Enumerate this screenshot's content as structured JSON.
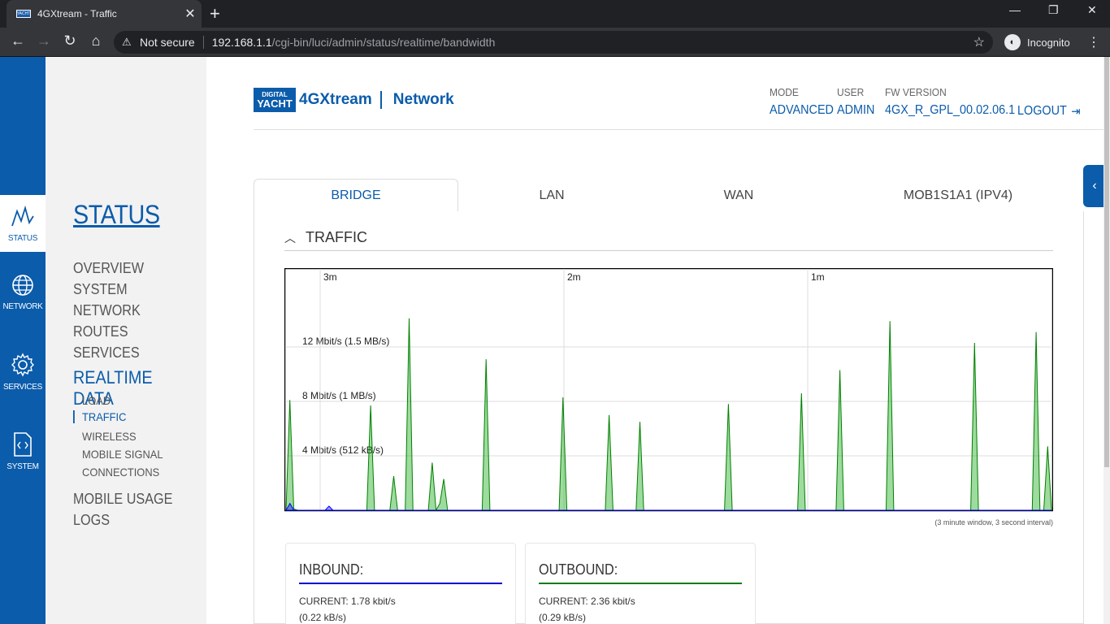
{
  "browser": {
    "tab_title": "4GXtream - Traffic",
    "tab_favicon_text": "YACHT",
    "url_security": "Not secure",
    "url_host": "192.168.1.1",
    "url_path": "/cgi-bin/luci/admin/status/realtime/bandwidth",
    "profile": "Incognito"
  },
  "iconbar": {
    "items": [
      {
        "label": "STATUS",
        "icon": "status-icon",
        "active": true
      },
      {
        "label": "NETWORK",
        "icon": "globe-icon",
        "active": false
      },
      {
        "label": "SERVICES",
        "icon": "gear-icon",
        "active": false
      },
      {
        "label": "SYSTEM",
        "icon": "system-icon",
        "active": false
      }
    ]
  },
  "sidebar": {
    "title": "STATUS",
    "items": [
      "OVERVIEW",
      "SYSTEM",
      "NETWORK",
      "ROUTES",
      "SERVICES"
    ],
    "active_item": "REALTIME DATA",
    "sub_items": [
      "LOAD",
      "TRAFFIC",
      "WIRELESS",
      "MOBILE SIGNAL",
      "CONNECTIONS"
    ],
    "active_sub": "TRAFFIC",
    "after_items": [
      "MOBILE USAGE",
      "LOGS"
    ]
  },
  "header": {
    "logo_top": "DIGITAL",
    "logo_bottom": "YACHT",
    "product": "4GXtream",
    "section": "Network",
    "mode_label": "MODE",
    "mode_value": "ADVANCED",
    "user_label": "USER",
    "user_value": "ADMIN",
    "fw_label": "FW VERSION",
    "fw_value": "4GX_R_GPL_00.02.06.1",
    "logout": "LOGOUT"
  },
  "tabs": [
    {
      "label": "BRIDGE",
      "active": true
    },
    {
      "label": "LAN",
      "active": false
    },
    {
      "label": "WAN",
      "active": false
    },
    {
      "label": "MOB1S1A1 (IPV4)",
      "active": false
    }
  ],
  "section": {
    "title": "TRAFFIC"
  },
  "chart_data": {
    "type": "area",
    "x_markers": [
      "3m",
      "2m",
      "1m"
    ],
    "y_ticks": [
      "12 Mbit/s (1.5 MB/s)",
      "8 Mbit/s (1 MB/s)",
      "4 Mbit/s (512 kB/s)"
    ],
    "y_tick_values_mbit": [
      12,
      8,
      4
    ],
    "ylim_mbit": [
      0,
      16
    ],
    "note": "(3 minute window, 3 second interval)",
    "series": [
      {
        "name": "OUTBOUND",
        "color": "#008000",
        "values": [
          0,
          8.1,
          0.1,
          0,
          0,
          0,
          0,
          0,
          0,
          0,
          0,
          0,
          0,
          0,
          0,
          0,
          0,
          0,
          0,
          0,
          0,
          0,
          7.7,
          0,
          0,
          0,
          0,
          0,
          2.5,
          0,
          0,
          0,
          14.1,
          0,
          0,
          0,
          0,
          0,
          3.5,
          0,
          0.5,
          2.3,
          0,
          0,
          0,
          0,
          0,
          0,
          0,
          0,
          0,
          0,
          11.1,
          0,
          0,
          0,
          0,
          0,
          0,
          0,
          0,
          0,
          0,
          0,
          0,
          0,
          0,
          0,
          0,
          0,
          0,
          0,
          8.3,
          0,
          0,
          0,
          0,
          0,
          0,
          0,
          0,
          0,
          0,
          0,
          7.0,
          0,
          0,
          0,
          0,
          0,
          0,
          0,
          6.5,
          0,
          0,
          0,
          0,
          0,
          0,
          0,
          0,
          0,
          0,
          0,
          0,
          0,
          0,
          0,
          0,
          0,
          0,
          0,
          0,
          0,
          0,
          7.8,
          0,
          0,
          0,
          0,
          0,
          0,
          0,
          0,
          0,
          0,
          0,
          0,
          0,
          0,
          0,
          0,
          0,
          0,
          8.6,
          0,
          0,
          0,
          0,
          0,
          0,
          0,
          0,
          0,
          10.3,
          0,
          0,
          0,
          0,
          0,
          0,
          0,
          0,
          0,
          0,
          0,
          0,
          13.9,
          0,
          0,
          0,
          0,
          0,
          0,
          0,
          0,
          0,
          0,
          0,
          0,
          0,
          0,
          0,
          0,
          0,
          0,
          0,
          0,
          0,
          12.3,
          0,
          0,
          0,
          0,
          0,
          0,
          0,
          0,
          0,
          0,
          0,
          0,
          0,
          0,
          0,
          13.1,
          0,
          0,
          4.7,
          0
        ]
      },
      {
        "name": "INBOUND",
        "color": "#0000ff",
        "values": [
          0,
          0.5,
          0,
          0,
          0,
          0,
          0,
          0,
          0,
          0,
          0,
          0.3,
          0,
          0,
          0,
          0,
          0,
          0,
          0,
          0,
          0,
          0,
          0,
          0,
          0,
          0,
          0,
          0,
          0,
          0,
          0,
          0,
          0,
          0,
          0,
          0,
          0,
          0,
          0,
          0,
          0,
          0,
          0,
          0,
          0,
          0,
          0,
          0,
          0,
          0,
          0,
          0,
          0,
          0,
          0,
          0,
          0,
          0,
          0,
          0,
          0,
          0,
          0,
          0,
          0,
          0,
          0,
          0,
          0,
          0,
          0,
          0,
          0,
          0,
          0,
          0,
          0,
          0,
          0,
          0,
          0,
          0,
          0,
          0,
          0,
          0,
          0,
          0,
          0,
          0,
          0,
          0,
          0,
          0,
          0,
          0,
          0,
          0,
          0,
          0,
          0,
          0,
          0,
          0,
          0,
          0,
          0,
          0,
          0,
          0,
          0,
          0,
          0,
          0,
          0,
          0,
          0,
          0,
          0,
          0,
          0,
          0,
          0,
          0,
          0,
          0,
          0,
          0,
          0,
          0,
          0,
          0,
          0,
          0,
          0,
          0,
          0,
          0,
          0,
          0,
          0,
          0,
          0,
          0,
          0,
          0,
          0,
          0,
          0,
          0,
          0,
          0,
          0,
          0,
          0,
          0,
          0,
          0,
          0,
          0,
          0,
          0,
          0,
          0,
          0,
          0,
          0,
          0,
          0,
          0,
          0,
          0,
          0,
          0,
          0,
          0,
          0,
          0,
          0,
          0,
          0,
          0,
          0,
          0,
          0,
          0,
          0,
          0,
          0,
          0,
          0,
          0,
          0,
          0,
          0,
          0,
          0
        ]
      }
    ]
  },
  "inbound": {
    "title": "INBOUND:",
    "current_label": "CURRENT:",
    "current_value": "1.78 kbit/s",
    "current_sub": "(0.22 kB/s)",
    "color": "#0000cc"
  },
  "outbound": {
    "title": "OUTBOUND:",
    "current_label": "CURRENT:",
    "current_value": "2.36 kbit/s",
    "current_sub": "(0.29 kB/s)",
    "color": "#1a7a1a"
  }
}
